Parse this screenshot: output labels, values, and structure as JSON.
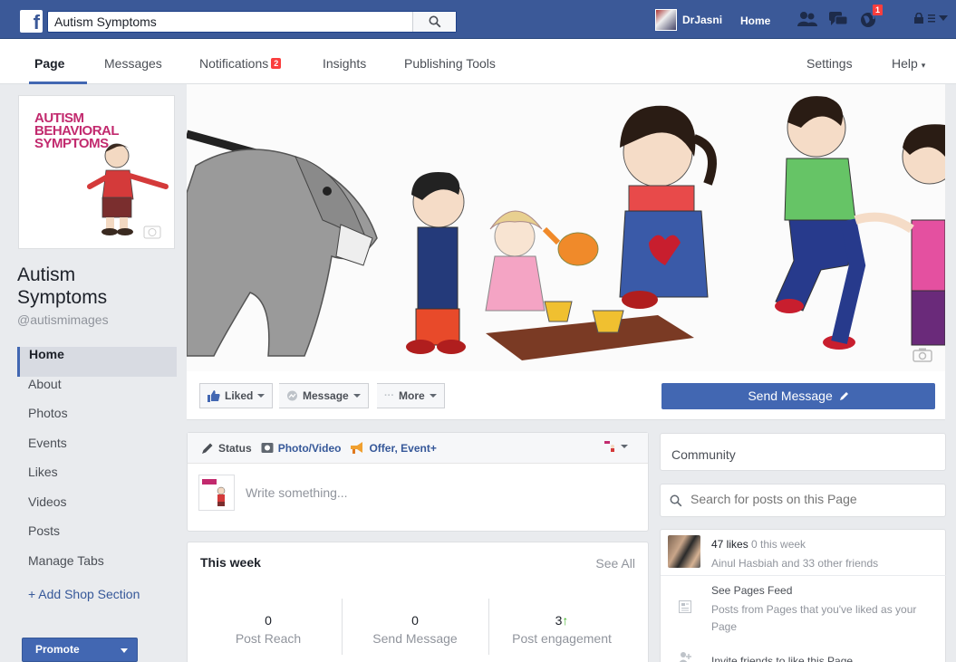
{
  "topbar": {
    "search_value": "Autism Symptoms",
    "user_name": "DrJasni",
    "home_label": "Home",
    "friend_requests_icon": "friends-icon",
    "messages_icon": "messages-icon",
    "notifications_icon": "globe-icon",
    "notifications_count": "1",
    "brand_color": "#3b5998"
  },
  "pagenav": {
    "tabs": [
      {
        "label": "Page"
      },
      {
        "label": "Messages"
      },
      {
        "label": "Notifications",
        "badge": "2"
      },
      {
        "label": "Insights"
      },
      {
        "label": "Publishing Tools"
      }
    ],
    "settings_label": "Settings",
    "help_label": "Help"
  },
  "profile": {
    "pic_text_lines": [
      "AUTISM",
      "BEHAVIORAL",
      "SYMPTOMS"
    ],
    "name_line1": "Autism",
    "name_line2": "Symptoms",
    "handle": "@autismimages"
  },
  "sidebar": {
    "items": [
      {
        "label": "Home"
      },
      {
        "label": "About"
      },
      {
        "label": "Photos"
      },
      {
        "label": "Events"
      },
      {
        "label": "Likes"
      },
      {
        "label": "Videos"
      },
      {
        "label": "Posts"
      },
      {
        "label": "Manage Tabs"
      }
    ],
    "add_shop": "+ Add Shop Section",
    "promote": "Promote"
  },
  "actions": {
    "liked": "Liked",
    "message": "Message",
    "more": "More",
    "send_message": "Send Message"
  },
  "composer": {
    "status": "Status",
    "photo_video": "Photo/Video",
    "offer_event": "Offer, Event+",
    "placeholder": "Write something..."
  },
  "week": {
    "title": "This week",
    "see_all": "See All",
    "stats": [
      {
        "value": "0",
        "label": "Post Reach"
      },
      {
        "value": "0",
        "label": "Send Message"
      },
      {
        "value": "3",
        "label": "Post engagement",
        "trend": "↑"
      }
    ]
  },
  "right": {
    "community": "Community",
    "search_placeholder": "Search for posts on this Page",
    "likes_count": "47 likes",
    "likes_week": "0 this week",
    "likes_friends": "Ainul Hasbiah and 33 other friends",
    "pages_feed_title": "See Pages Feed",
    "pages_feed_desc": "Posts from Pages that you've liked as your Page",
    "invite": "Invite friends to like this Page"
  }
}
